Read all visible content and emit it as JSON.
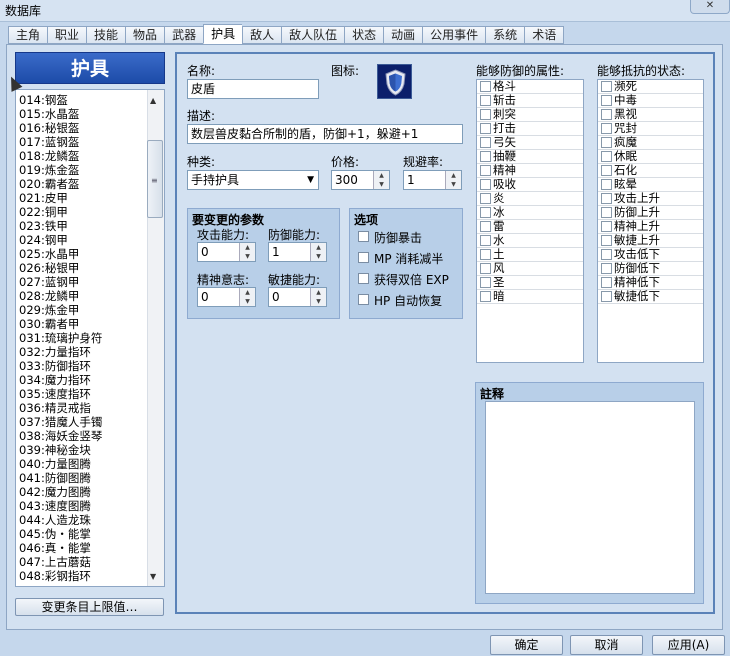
{
  "window": {
    "title": "数据库",
    "close_icon": "close-icon"
  },
  "tabs": [
    "主角",
    "职业",
    "技能",
    "物品",
    "武器",
    "护具",
    "敌人",
    "敌人队伍",
    "状态",
    "动画",
    "公用事件",
    "系统",
    "术语"
  ],
  "active_tab": "护具",
  "left": {
    "header": "护具",
    "items": [
      "014:钢盔",
      "015:水晶盔",
      "016:秘银盔",
      "017:蓝钢盔",
      "018:龙鳞盔",
      "019:炼金盔",
      "020:霸者盔",
      "021:皮甲",
      "022:铜甲",
      "023:铁甲",
      "024:钢甲",
      "025:水晶甲",
      "026:秘银甲",
      "027:蓝钢甲",
      "028:龙鳞甲",
      "029:炼金甲",
      "030:霸者甲",
      "031:琉璃护身符",
      "032:力量指环",
      "033:防御指环",
      "034:魔力指环",
      "035:速度指环",
      "036:精灵戒指",
      "037:猎魔人手镯",
      "038:海妖金竖琴",
      "039:神秘金块",
      "040:力量图腾",
      "041:防御图腾",
      "042:魔力图腾",
      "043:速度图腾",
      "044:人造龙珠",
      "045:伪・能掌",
      "046:真・能掌",
      "047:上古蘑菇",
      "048:彩钢指环"
    ],
    "max_button": "变更条目上限值…"
  },
  "form": {
    "name_label": "名称:",
    "name_value": "皮盾",
    "icon_label": "图标:",
    "desc_label": "描述:",
    "desc_value": "数层兽皮黏合所制的盾，防御+1，躲避+1",
    "kind_label": "种类:",
    "kind_value": "手持护具",
    "price_label": "价格:",
    "price_value": "300",
    "evade_label": "规避率:",
    "evade_value": "1",
    "params_title": "要变更的参数",
    "atk_label": "攻击能力:",
    "atk_value": "0",
    "def_label": "防御能力:",
    "def_value": "1",
    "spi_label": "精神意志:",
    "spi_value": "0",
    "agi_label": "敏捷能力:",
    "agi_value": "0",
    "options_title": "选项",
    "options": [
      "防御暴击",
      "MP 消耗减半",
      "获得双倍 EXP",
      "HP 自动恢复"
    ],
    "attr_title": "能够防御的属性:",
    "attrs": [
      "格斗",
      "斩击",
      "刺突",
      "打击",
      "弓矢",
      "抽鞭",
      "精神",
      "吸收",
      "炎",
      "冰",
      "雷",
      "水",
      "土",
      "风",
      "圣",
      "暗"
    ],
    "state_title": "能够抵抗的状态:",
    "states": [
      "濒死",
      "中毒",
      "黑视",
      "咒封",
      "疯魔",
      "休眠",
      "石化",
      "眩晕",
      "攻击上升",
      "防御上升",
      "精神上升",
      "敏捷上升",
      "攻击低下",
      "防御低下",
      "精神低下",
      "敏捷低下"
    ],
    "note_title": "註释"
  },
  "buttons": {
    "ok": "确定",
    "cancel": "取消",
    "apply": "应用(A)"
  }
}
